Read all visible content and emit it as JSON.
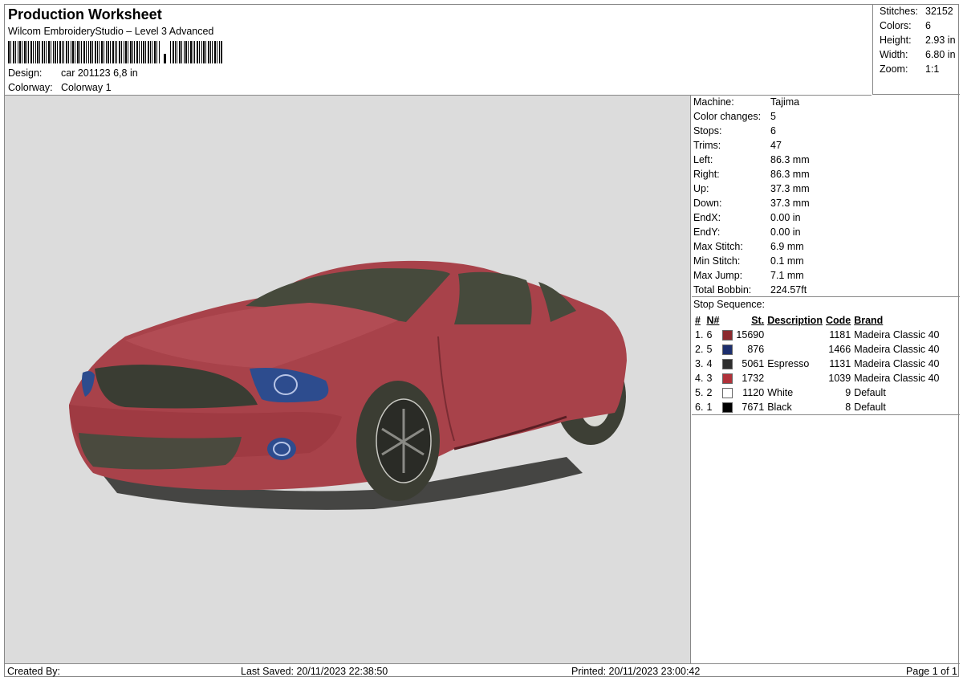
{
  "header": {
    "title": "Production Worksheet",
    "subtitle": "Wilcom EmbroideryStudio – Level 3 Advanced",
    "design_label": "Design:",
    "design_value": "car 201123 6,8 in",
    "colorway_label": "Colorway:",
    "colorway_value": "Colorway 1"
  },
  "summary": [
    {
      "label": "Stitches:",
      "value": "32152"
    },
    {
      "label": "Colors:",
      "value": "6"
    },
    {
      "label": "Height:",
      "value": "2.93 in"
    },
    {
      "label": "Width:",
      "value": "6.80 in"
    },
    {
      "label": "Zoom:",
      "value": "1:1"
    }
  ],
  "machine_info": [
    {
      "label": "Machine:",
      "value": "Tajima"
    },
    {
      "label": "Color changes:",
      "value": "5"
    },
    {
      "label": "Stops:",
      "value": "6"
    },
    {
      "label": "Trims:",
      "value": "47"
    },
    {
      "label": "Left:",
      "value": "86.3 mm"
    },
    {
      "label": "Right:",
      "value": "86.3 mm"
    },
    {
      "label": "Up:",
      "value": "37.3 mm"
    },
    {
      "label": "Down:",
      "value": "37.3 mm"
    },
    {
      "label": "EndX:",
      "value": "0.00 in"
    },
    {
      "label": "EndY:",
      "value": "0.00 in"
    },
    {
      "label": "Max Stitch:",
      "value": "6.9 mm"
    },
    {
      "label": "Min Stitch:",
      "value": "0.1 mm"
    },
    {
      "label": "Max Jump:",
      "value": "7.1 mm"
    },
    {
      "label": "Total Bobbin:",
      "value": "224.57ft"
    }
  ],
  "stop_sequence": {
    "title": "Stop Sequence:",
    "headers": {
      "num": "#",
      "n": "N#",
      "st": "St.",
      "desc": "Description",
      "code": "Code",
      "brand": "Brand"
    },
    "rows": [
      {
        "num": "1.",
        "n": "6",
        "color": "#8b2a2e",
        "st": "15690",
        "desc": "",
        "code": "1181",
        "brand": "Madeira Classic 40"
      },
      {
        "num": "2.",
        "n": "5",
        "color": "#1d2f6e",
        "st": "876",
        "desc": "",
        "code": "1466",
        "brand": "Madeira Classic 40"
      },
      {
        "num": "3.",
        "n": "4",
        "color": "#2e2e2e",
        "st": "5061",
        "desc": "Espresso",
        "code": "1131",
        "brand": "Madeira Classic 40"
      },
      {
        "num": "4.",
        "n": "3",
        "color": "#b0323a",
        "st": "1732",
        "desc": "",
        "code": "1039",
        "brand": "Madeira Classic 40"
      },
      {
        "num": "5.",
        "n": "2",
        "color": "#ffffff",
        "st": "1120",
        "desc": "White",
        "code": "9",
        "brand": "Default"
      },
      {
        "num": "6.",
        "n": "1",
        "color": "#000000",
        "st": "7671",
        "desc": "Black",
        "code": "8",
        "brand": "Default"
      }
    ]
  },
  "footer": {
    "created_by": "Created By:",
    "last_saved": "Last Saved: 20/11/2023 22:38:50",
    "printed": "Printed: 20/11/2023 23:00:42",
    "page": "Page 1 of 1"
  }
}
